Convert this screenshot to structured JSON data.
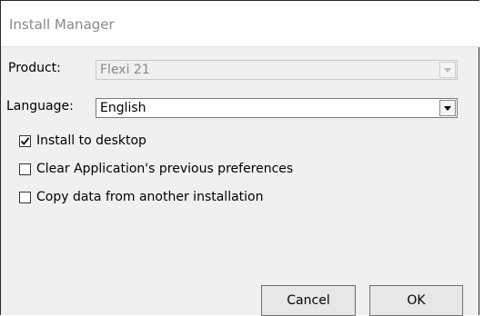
{
  "window": {
    "title": "Install Manager"
  },
  "form": {
    "product": {
      "label": "Product:",
      "value": "Flexi 21",
      "enabled": false
    },
    "language": {
      "label": "Language:",
      "value": "English",
      "enabled": true
    },
    "options": [
      {
        "label": "Install to desktop",
        "checked": true
      },
      {
        "label": "Clear Application's previous preferences",
        "checked": false
      },
      {
        "label": "Copy data from another installation",
        "checked": false
      }
    ]
  },
  "buttons": {
    "cancel_label": "Cancel",
    "ok_label": "OK"
  },
  "icons": {
    "dropdown": "chevron-down-icon",
    "check": "checkmark-icon"
  }
}
